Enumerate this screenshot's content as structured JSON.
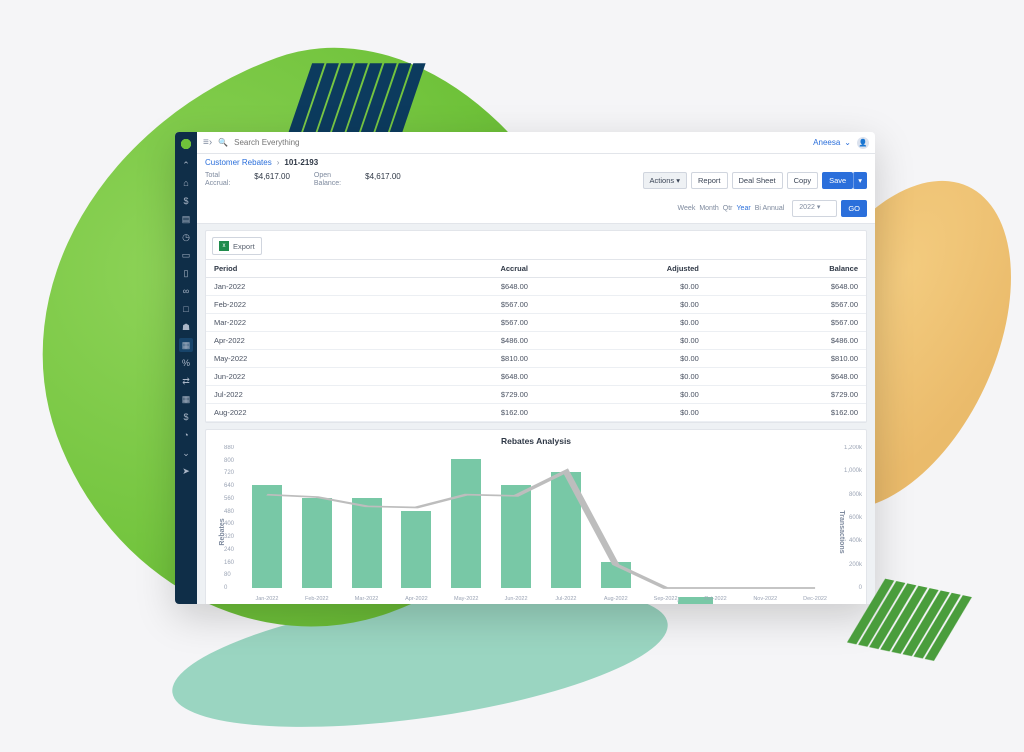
{
  "search": {
    "placeholder": "Search Everything"
  },
  "user": {
    "name": "Aneesa"
  },
  "breadcrumb": {
    "parent": "Customer Rebates",
    "sep": "›",
    "current": "101-2193"
  },
  "metrics": {
    "total_accrual_label": "Total\nAccrual:",
    "total_accrual_value": "$4,617.00",
    "open_balance_label": "Open\nBalance:",
    "open_balance_value": "$4,617.00"
  },
  "buttons": {
    "actions": "Actions",
    "report": "Report",
    "deal_sheet": "Deal Sheet",
    "copy": "Copy",
    "save": "Save",
    "go": "GO",
    "export": "Export"
  },
  "timeframe": {
    "options": [
      "Week",
      "Month",
      "Qtr",
      "Year",
      "Bi Annual"
    ],
    "selected_index": 3,
    "year": "2022"
  },
  "table": {
    "headers": {
      "period": "Period",
      "accrual": "Accrual",
      "adjusted": "Adjusted",
      "balance": "Balance"
    },
    "rows": [
      {
        "period": "Jan-2022",
        "accrual": "$648.00",
        "adjusted": "$0.00",
        "balance": "$648.00"
      },
      {
        "period": "Feb-2022",
        "accrual": "$567.00",
        "adjusted": "$0.00",
        "balance": "$567.00"
      },
      {
        "period": "Mar-2022",
        "accrual": "$567.00",
        "adjusted": "$0.00",
        "balance": "$567.00"
      },
      {
        "period": "Apr-2022",
        "accrual": "$486.00",
        "adjusted": "$0.00",
        "balance": "$486.00"
      },
      {
        "period": "May-2022",
        "accrual": "$810.00",
        "adjusted": "$0.00",
        "balance": "$810.00"
      },
      {
        "period": "Jun-2022",
        "accrual": "$648.00",
        "adjusted": "$0.00",
        "balance": "$648.00"
      },
      {
        "period": "Jul-2022",
        "accrual": "$729.00",
        "adjusted": "$0.00",
        "balance": "$729.00"
      },
      {
        "period": "Aug-2022",
        "accrual": "$162.00",
        "adjusted": "$0.00",
        "balance": "$162.00"
      }
    ]
  },
  "chart_data": {
    "type": "bar",
    "title": "Rebates Analysis",
    "ylabel_left": "Rebates",
    "ylabel_right": "Transactions",
    "x_labels": [
      "Jan-2022",
      "Feb-2022",
      "Mar-2022",
      "Apr-2022",
      "May-2022",
      "Jun-2022",
      "Jul-2022",
      "Aug-2022",
      "Sep-2022",
      "Oct-2022",
      "Nov-2022",
      "Dec-2022"
    ],
    "y_left_ticks": [
      0,
      80,
      160,
      240,
      320,
      400,
      480,
      560,
      640,
      720,
      800,
      880
    ],
    "y_left_lim": [
      0,
      880
    ],
    "y_right_ticks": [
      "0",
      "200k",
      "400k",
      "600k",
      "800k",
      "1,000k",
      "1,200k"
    ],
    "y_right_lim": [
      0,
      1200
    ],
    "series": [
      {
        "name": "Rebates",
        "kind": "bar",
        "axis": "left",
        "values": [
          648,
          567,
          567,
          486,
          810,
          648,
          729,
          162,
          0,
          0,
          0,
          0
        ]
      },
      {
        "name": "Transactions",
        "kind": "line",
        "axis": "right",
        "values": [
          800,
          780,
          700,
          690,
          800,
          790,
          1000,
          200,
          0,
          0,
          0,
          0
        ]
      }
    ]
  },
  "sidebar_icons": [
    "caret-up",
    "home",
    "billing",
    "document",
    "gauge",
    "desktop",
    "clipboard",
    "infinity",
    "card",
    "briefcase",
    "chart",
    "link",
    "reconcile",
    "grid",
    "credit",
    "pie",
    "caret-down",
    "pointer"
  ]
}
